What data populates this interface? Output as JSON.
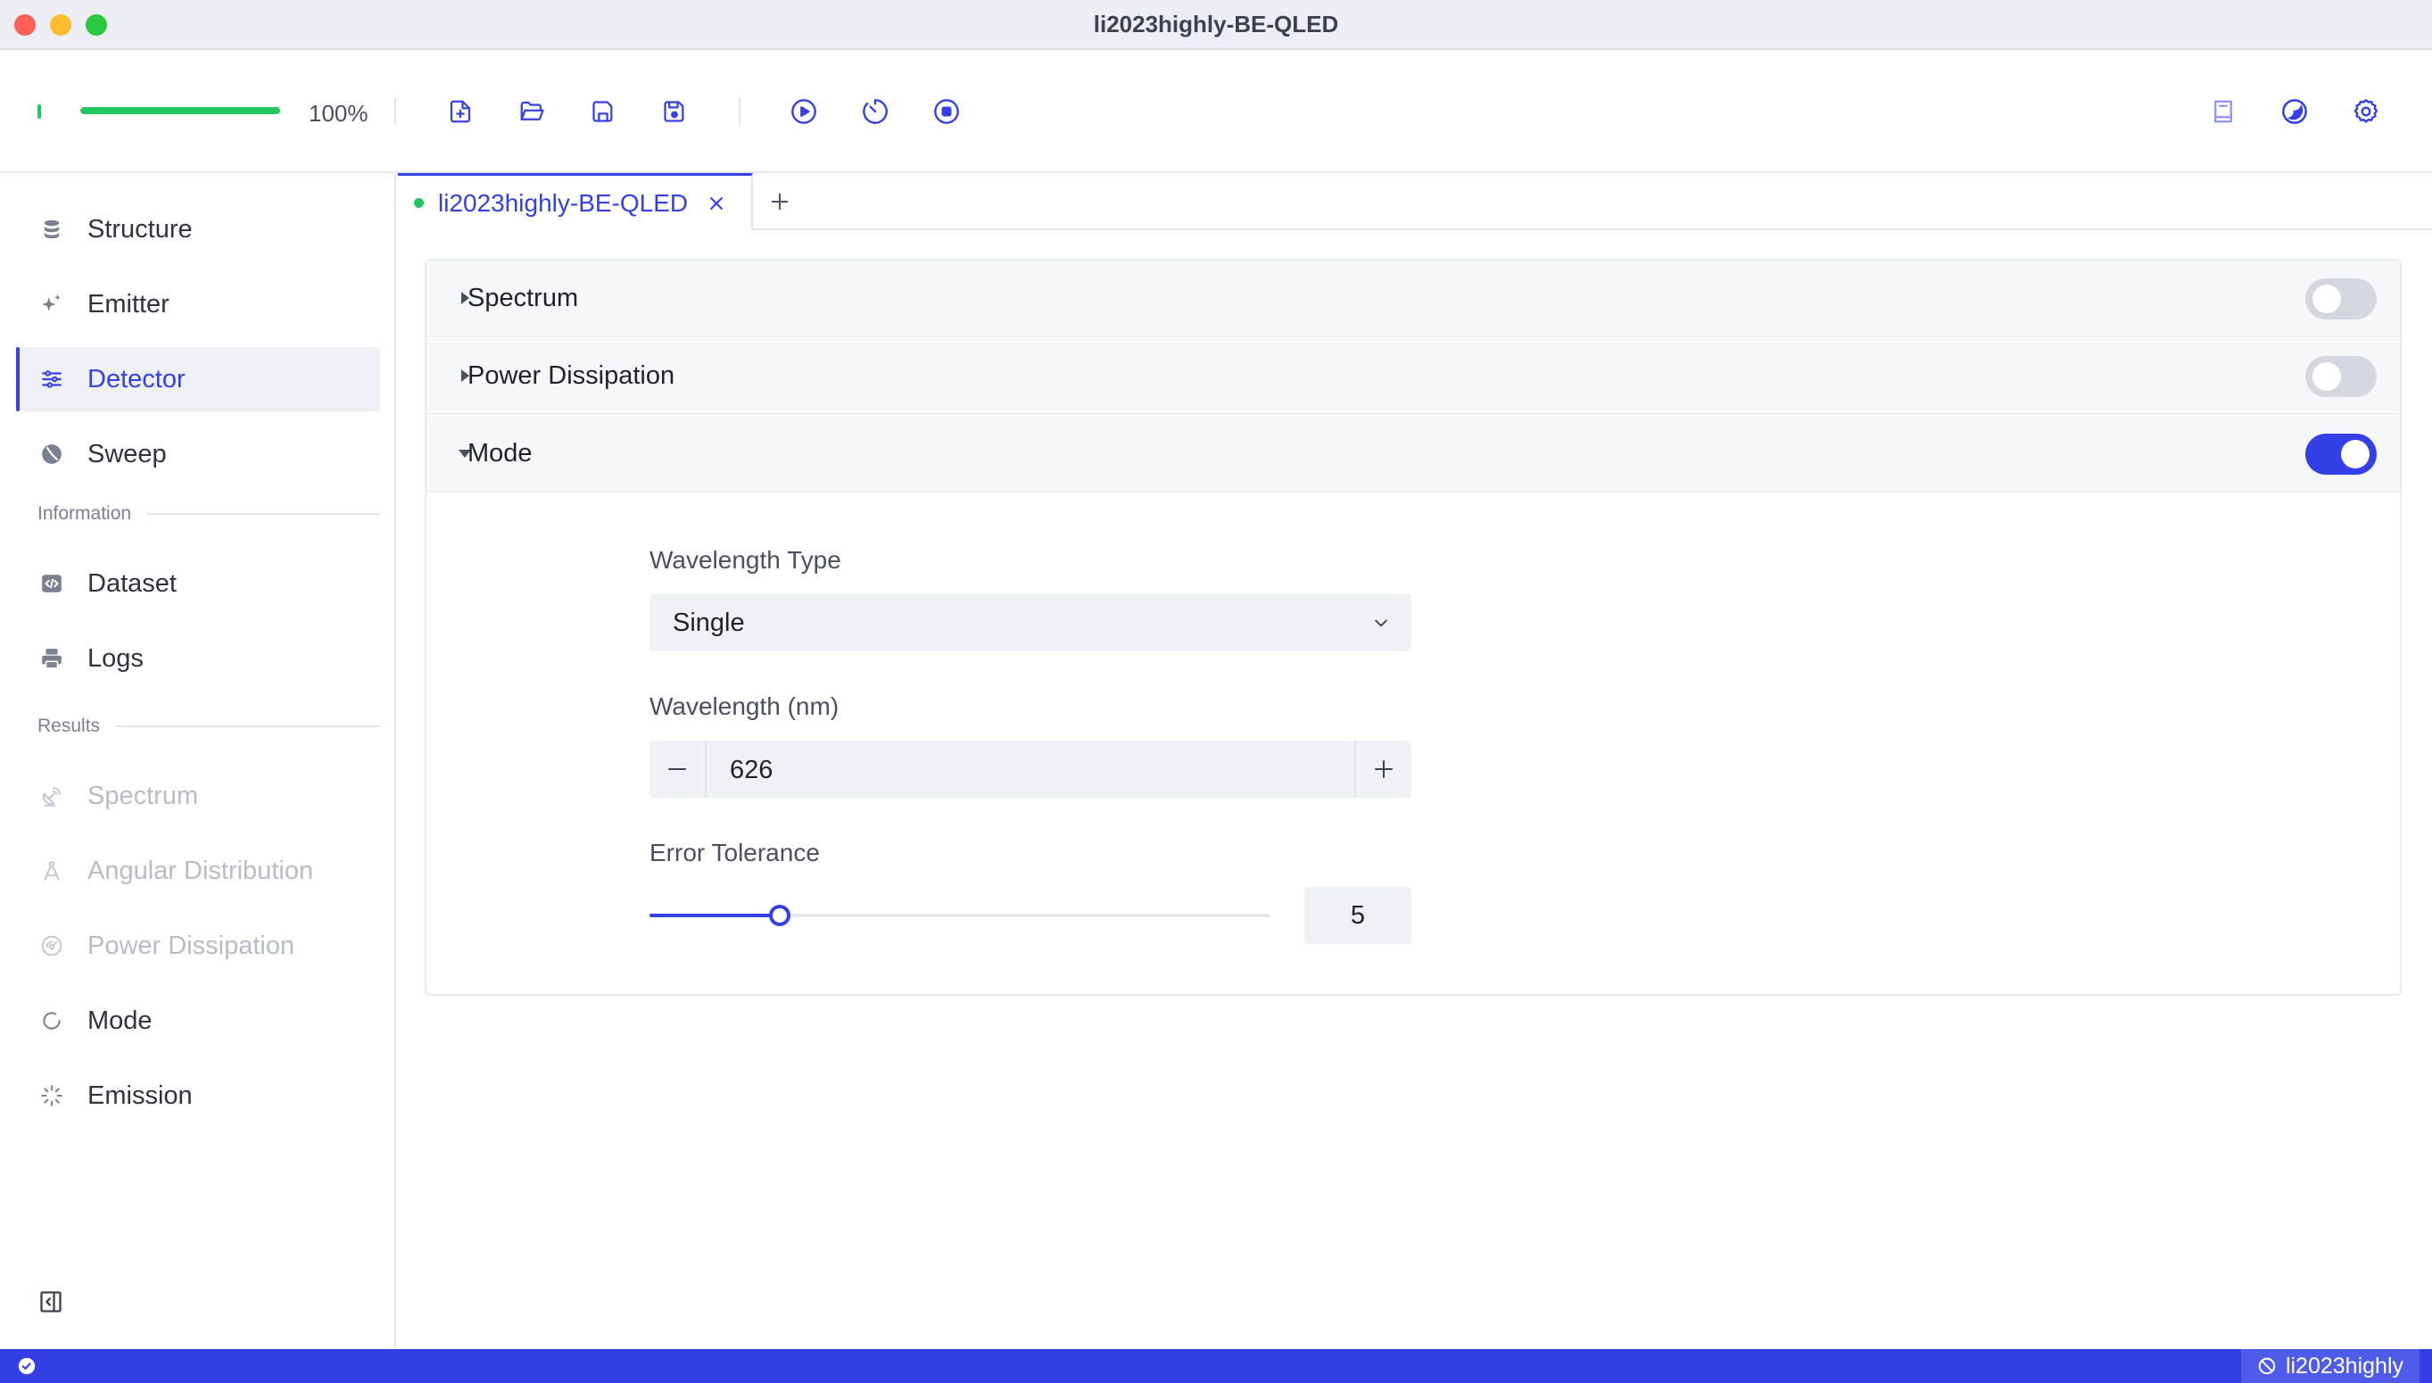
{
  "window": {
    "title": "li2023highly-BE-QLED"
  },
  "toolbar": {
    "progress_label": "100%",
    "progress_fraction": 1.0
  },
  "sidebar": {
    "items": [
      {
        "label": "Structure"
      },
      {
        "label": "Emitter"
      },
      {
        "label": "Detector"
      },
      {
        "label": "Sweep"
      }
    ],
    "information_header": "Information",
    "information_items": [
      {
        "label": "Dataset"
      },
      {
        "label": "Logs"
      }
    ],
    "results_header": "Results",
    "results_items": [
      {
        "label": "Spectrum"
      },
      {
        "label": "Angular Distribution"
      },
      {
        "label": "Power Dissipation"
      },
      {
        "label": "Mode"
      },
      {
        "label": "Emission"
      }
    ]
  },
  "tabs": [
    {
      "label": "li2023highly-BE-QLED"
    }
  ],
  "panel": {
    "sections": [
      {
        "title": "Spectrum",
        "enabled": false,
        "expanded": false
      },
      {
        "title": "Power Dissipation",
        "enabled": false,
        "expanded": false
      },
      {
        "title": "Mode",
        "enabled": true,
        "expanded": true
      }
    ],
    "mode": {
      "wavelength_type_label": "Wavelength Type",
      "wavelength_type_value": "Single",
      "wavelength_label": "Wavelength (nm)",
      "wavelength_value": "626",
      "error_tolerance_label": "Error Tolerance",
      "error_tolerance_value": "5",
      "error_tolerance_fraction": 0.21
    }
  },
  "statusbar": {
    "project": "li2023highly"
  },
  "colors": {
    "accent": "#3440e6",
    "success": "#22c55e",
    "status_bar": "#3440e6"
  }
}
